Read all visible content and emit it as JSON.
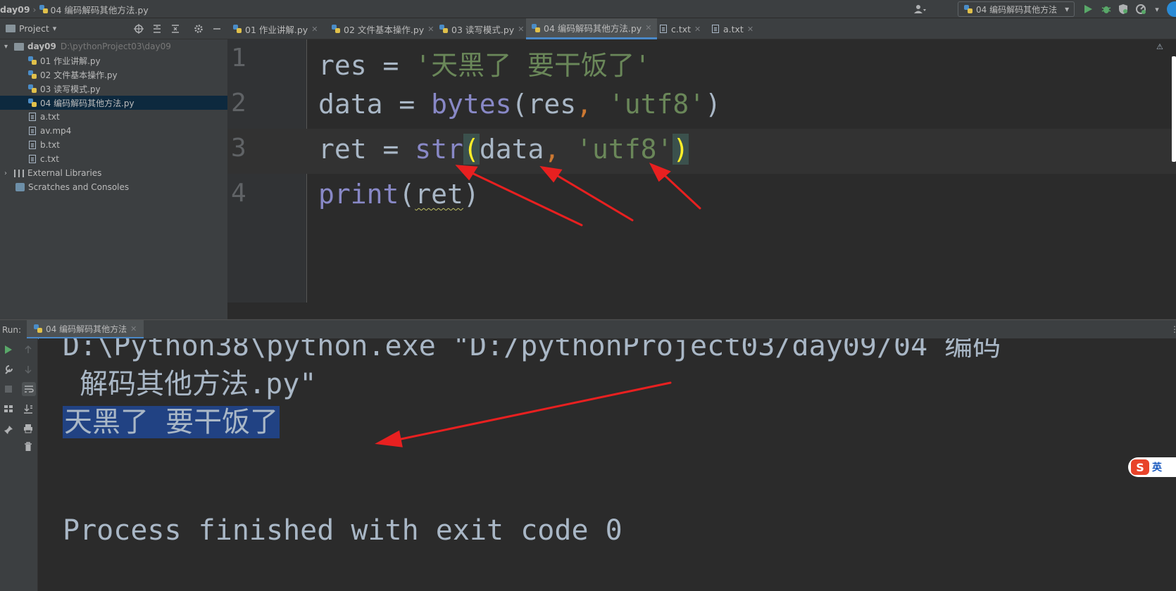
{
  "nav": {
    "project": "day09",
    "file": "04 编码解码其他方法.py"
  },
  "toolbar": {
    "run_config": "04 编码解码其他方法"
  },
  "project_panel": {
    "title": "Project",
    "root_name": "day09",
    "root_path": "D:\\pythonProject03\\day09",
    "files": [
      "01 作业讲解.py",
      "02 文件基本操作.py",
      "03 读写模式.py",
      "04 编码解码其他方法.py",
      "a.txt",
      "av.mp4",
      "b.txt",
      "c.txt"
    ],
    "external_libraries": "External Libraries",
    "scratches": "Scratches and Consoles"
  },
  "tabs": [
    "01 作业讲解.py",
    "02 文件基本操作.py",
    "03 读写模式.py",
    "04 编码解码其他方法.py",
    "c.txt",
    "a.txt"
  ],
  "editor": {
    "line_numbers": [
      "1",
      "2",
      "3",
      "4"
    ],
    "line1": {
      "var": "res",
      "eq": " = ",
      "str": "'天黑了 要干饭了'"
    },
    "line2": {
      "var": "data",
      "eq": " = ",
      "fn": "bytes",
      "open": "(",
      "arg": "res",
      "comma": ",",
      "str": " 'utf8'",
      "close": ")"
    },
    "line3": {
      "var": "ret",
      "eq": " = ",
      "fn": "str",
      "open": "(",
      "arg": "data",
      "comma": ",",
      "str": " 'utf8'",
      "close": ")"
    },
    "line4": {
      "fn": "print",
      "open": "(",
      "arg": "ret",
      "close": ")"
    }
  },
  "run": {
    "label": "Run:",
    "tab": "04 编码解码其他方法",
    "command_line1": "D:\\Python38\\python.exe \"D:/pythonProject03/day09/04 编码",
    "command_line2": " 解码其他方法.py\"",
    "output": "天黑了 要干饭了",
    "exit_message": "Process finished with exit code 0"
  },
  "ime": {
    "label": "英"
  },
  "colors": {
    "annotation_arrow": "#e82020",
    "selection": "#214283",
    "accent": "#4a88c7"
  }
}
